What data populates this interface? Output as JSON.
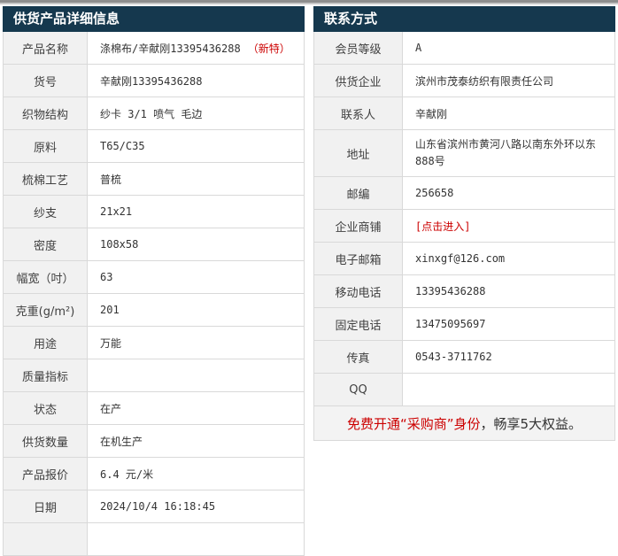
{
  "colors": {
    "header_bg": "#15384e",
    "header_text": "#ffffff",
    "label_bg": "#f1f1f1",
    "border": "#d9d9d9",
    "text": "#333333",
    "accent_red": "#cc0000",
    "promo_bg": "#f3f3f3"
  },
  "product_table": {
    "title": "供货产品详细信息",
    "rows": [
      {
        "label": "产品名称",
        "value": "涤棉布/辛献刚13395436288",
        "badge": "（新特）"
      },
      {
        "label": "货号",
        "value": "辛献刚13395436288"
      },
      {
        "label": "织物结构",
        "value": "纱卡 3/1 喷气 毛边"
      },
      {
        "label": "原料",
        "value": "T65/C35"
      },
      {
        "label": "梳棉工艺",
        "value": "普梳"
      },
      {
        "label": "纱支",
        "value": "21x21"
      },
      {
        "label": "密度",
        "value": "108x58"
      },
      {
        "label": "幅宽（吋）",
        "value": "63"
      },
      {
        "label": "克重(g/m²)",
        "value": "201"
      },
      {
        "label": "用途",
        "value": "万能"
      },
      {
        "label": "质量指标",
        "value": ""
      },
      {
        "label": "状态",
        "value": "在产"
      },
      {
        "label": "供货数量",
        "value": "在机生产"
      },
      {
        "label": "产品报价",
        "value": "6.4 元/米"
      },
      {
        "label": "日期",
        "value": "2024/10/4 16:18:45"
      },
      {
        "label": "",
        "value": ""
      }
    ]
  },
  "contact_table": {
    "title": "联系方式",
    "rows": [
      {
        "label": "会员等级",
        "value": "A"
      },
      {
        "label": "供货企业",
        "value": "滨州市茂泰纺织有限责任公司"
      },
      {
        "label": "联系人",
        "value": "辛献刚"
      },
      {
        "label": "地址",
        "value": "山东省滨州市黄河八路以南东外环以东888号"
      },
      {
        "label": "邮编",
        "value": "256658"
      },
      {
        "label": "企业商铺",
        "link": "[点击进入]"
      },
      {
        "label": "电子邮箱",
        "value": "xinxgf@126.com"
      },
      {
        "label": "移动电话",
        "value": "13395436288"
      },
      {
        "label": "固定电话",
        "value": "13475095697"
      },
      {
        "label": "传真",
        "value": "0543-3711762"
      },
      {
        "label": "QQ",
        "value": ""
      }
    ],
    "promo": {
      "red_text": "免费开通“采购商”身份",
      "normal_text": "，畅享5大权益。"
    }
  }
}
